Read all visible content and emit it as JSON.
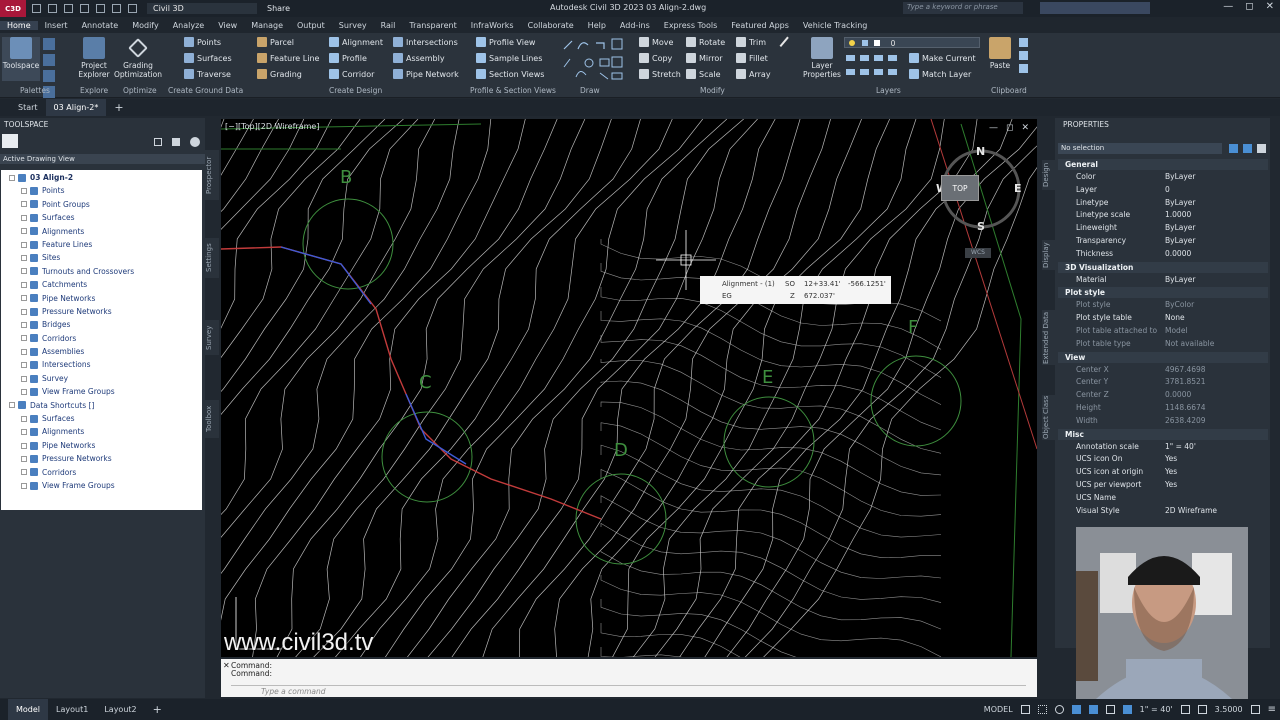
{
  "titlebar": {
    "logo": "C3D",
    "workspace": "Civil 3D",
    "share": "Share",
    "title": "Autodesk Civil 3D 2023   03 Align-2.dwg",
    "search_placeholder": "Type a keyword or phrase"
  },
  "menu_tabs": [
    "Home",
    "Insert",
    "Annotate",
    "Modify",
    "Analyze",
    "View",
    "Manage",
    "Output",
    "Survey",
    "Rail",
    "Transparent",
    "InfraWorks",
    "Collaborate",
    "Help",
    "Add-ins",
    "Express Tools",
    "Featured Apps",
    "Vehicle Tracking"
  ],
  "ribbon": {
    "big_buttons": [
      {
        "label": "Toolspace"
      },
      {
        "label": "Project\nExplorer"
      },
      {
        "label": "Grading\nOptimization"
      }
    ],
    "create_ground": [
      [
        "Points",
        "Surfaces",
        "Traverse"
      ],
      [
        "Parcel",
        "Feature Line",
        "Grading"
      ]
    ],
    "create_design": [
      [
        "Alignment",
        "Profile",
        "Corridor"
      ],
      [
        "Intersections",
        "Assembly",
        "Pipe Network"
      ]
    ],
    "profile_section": [
      "Profile View",
      "Sample Lines",
      "Section Views"
    ],
    "modify": [
      [
        "Move",
        "Copy",
        "Stretch"
      ],
      [
        "Rotate",
        "Mirror",
        "Scale"
      ],
      [
        "Trim",
        "Fillet",
        "Array"
      ]
    ],
    "layers_big": "Layer\nProperties",
    "layers_value": "0",
    "layers": [
      "Make Current",
      "Match Layer"
    ],
    "paste": "Paste",
    "panel_labels": [
      "Palettes",
      "Explore",
      "Optimize",
      "Create Ground Data",
      "Create Design",
      "Profile & Section Views",
      "Draw",
      "Modify",
      "Layers",
      "Clipboard"
    ]
  },
  "doc_tabs": [
    "Start",
    "03 Align-2*"
  ],
  "toolspace": {
    "title": "TOOLSPACE",
    "view_select": "Active Drawing View",
    "tree": [
      {
        "label": "03 Align-2",
        "level": 0,
        "bold": true
      },
      {
        "label": "Points",
        "level": 1
      },
      {
        "label": "Point Groups",
        "level": 1
      },
      {
        "label": "Surfaces",
        "level": 1
      },
      {
        "label": "Alignments",
        "level": 1
      },
      {
        "label": "Feature Lines",
        "level": 1
      },
      {
        "label": "Sites",
        "level": 1
      },
      {
        "label": "Turnouts and Crossovers",
        "level": 1
      },
      {
        "label": "Catchments",
        "level": 1
      },
      {
        "label": "Pipe Networks",
        "level": 1
      },
      {
        "label": "Pressure Networks",
        "level": 1
      },
      {
        "label": "Bridges",
        "level": 1
      },
      {
        "label": "Corridors",
        "level": 1
      },
      {
        "label": "Assemblies",
        "level": 1
      },
      {
        "label": "Intersections",
        "level": 1
      },
      {
        "label": "Survey",
        "level": 1
      },
      {
        "label": "View Frame Groups",
        "level": 1
      },
      {
        "label": "Data Shortcuts []",
        "level": 0
      },
      {
        "label": "Surfaces",
        "level": 1
      },
      {
        "label": "Alignments",
        "level": 1
      },
      {
        "label": "Pipe Networks",
        "level": 1
      },
      {
        "label": "Pressure Networks",
        "level": 1
      },
      {
        "label": "Corridors",
        "level": 1
      },
      {
        "label": "View Frame Groups",
        "level": 1
      }
    ],
    "side_tabs": [
      "Prospector",
      "Settings",
      "Survey",
      "Toolbox"
    ]
  },
  "viewport": {
    "label": "[−][Top][2D Wireframe]",
    "compass": {
      "n": "N",
      "s": "S",
      "e": "E",
      "w": "W",
      "top": "TOP",
      "wcs": "WCS"
    },
    "letters": [
      "B",
      "C",
      "D",
      "E",
      "F"
    ],
    "tooltip": {
      "name": "Alignment - (1)",
      "so_key": "SO",
      "so_val": "12+33.41'",
      "offset": "-566.1251'",
      "eg": "EG",
      "z_key": "Z",
      "z_val": "672.037'"
    },
    "watermark": "www.civil3d.tv"
  },
  "command": {
    "line1": "Command:",
    "line2": "Command:",
    "placeholder": "Type a command"
  },
  "properties": {
    "title": "PROPERTIES",
    "selection": "No selection",
    "side_tabs": [
      "Design",
      "Display",
      "Extended Data",
      "Object Class"
    ],
    "sections": [
      {
        "name": "General",
        "rows": [
          [
            "Color",
            "ByLayer"
          ],
          [
            "Layer",
            "0"
          ],
          [
            "Linetype",
            "ByLayer"
          ],
          [
            "Linetype scale",
            "1.0000"
          ],
          [
            "Lineweight",
            "ByLayer"
          ],
          [
            "Transparency",
            "ByLayer"
          ],
          [
            "Thickness",
            "0.0000"
          ]
        ]
      },
      {
        "name": "3D Visualization",
        "rows": [
          [
            "Material",
            "ByLayer"
          ]
        ]
      },
      {
        "name": "Plot style",
        "rows": [
          [
            "Plot style",
            "ByColor"
          ],
          [
            "Plot style table",
            "None"
          ],
          [
            "Plot table attached to",
            "Model"
          ],
          [
            "Plot table type",
            "Not available"
          ]
        ]
      },
      {
        "name": "View",
        "rows": [
          [
            "Center X",
            "4967.4698"
          ],
          [
            "Center Y",
            "3781.8521"
          ],
          [
            "Center Z",
            "0.0000"
          ],
          [
            "Height",
            "1148.6674"
          ],
          [
            "Width",
            "2638.4209"
          ]
        ]
      },
      {
        "name": "Misc",
        "rows": [
          [
            "Annotation scale",
            "1\" = 40'"
          ],
          [
            "UCS icon On",
            "Yes"
          ],
          [
            "UCS icon at origin",
            "Yes"
          ],
          [
            "UCS per viewport",
            "Yes"
          ],
          [
            "UCS Name",
            ""
          ],
          [
            "Visual Style",
            "2D Wireframe"
          ]
        ]
      }
    ]
  },
  "status": {
    "tabs": [
      "Model",
      "Layout1",
      "Layout2"
    ],
    "model_label": "MODEL",
    "scale": "1\" = 40'",
    "value": "3.5000"
  }
}
